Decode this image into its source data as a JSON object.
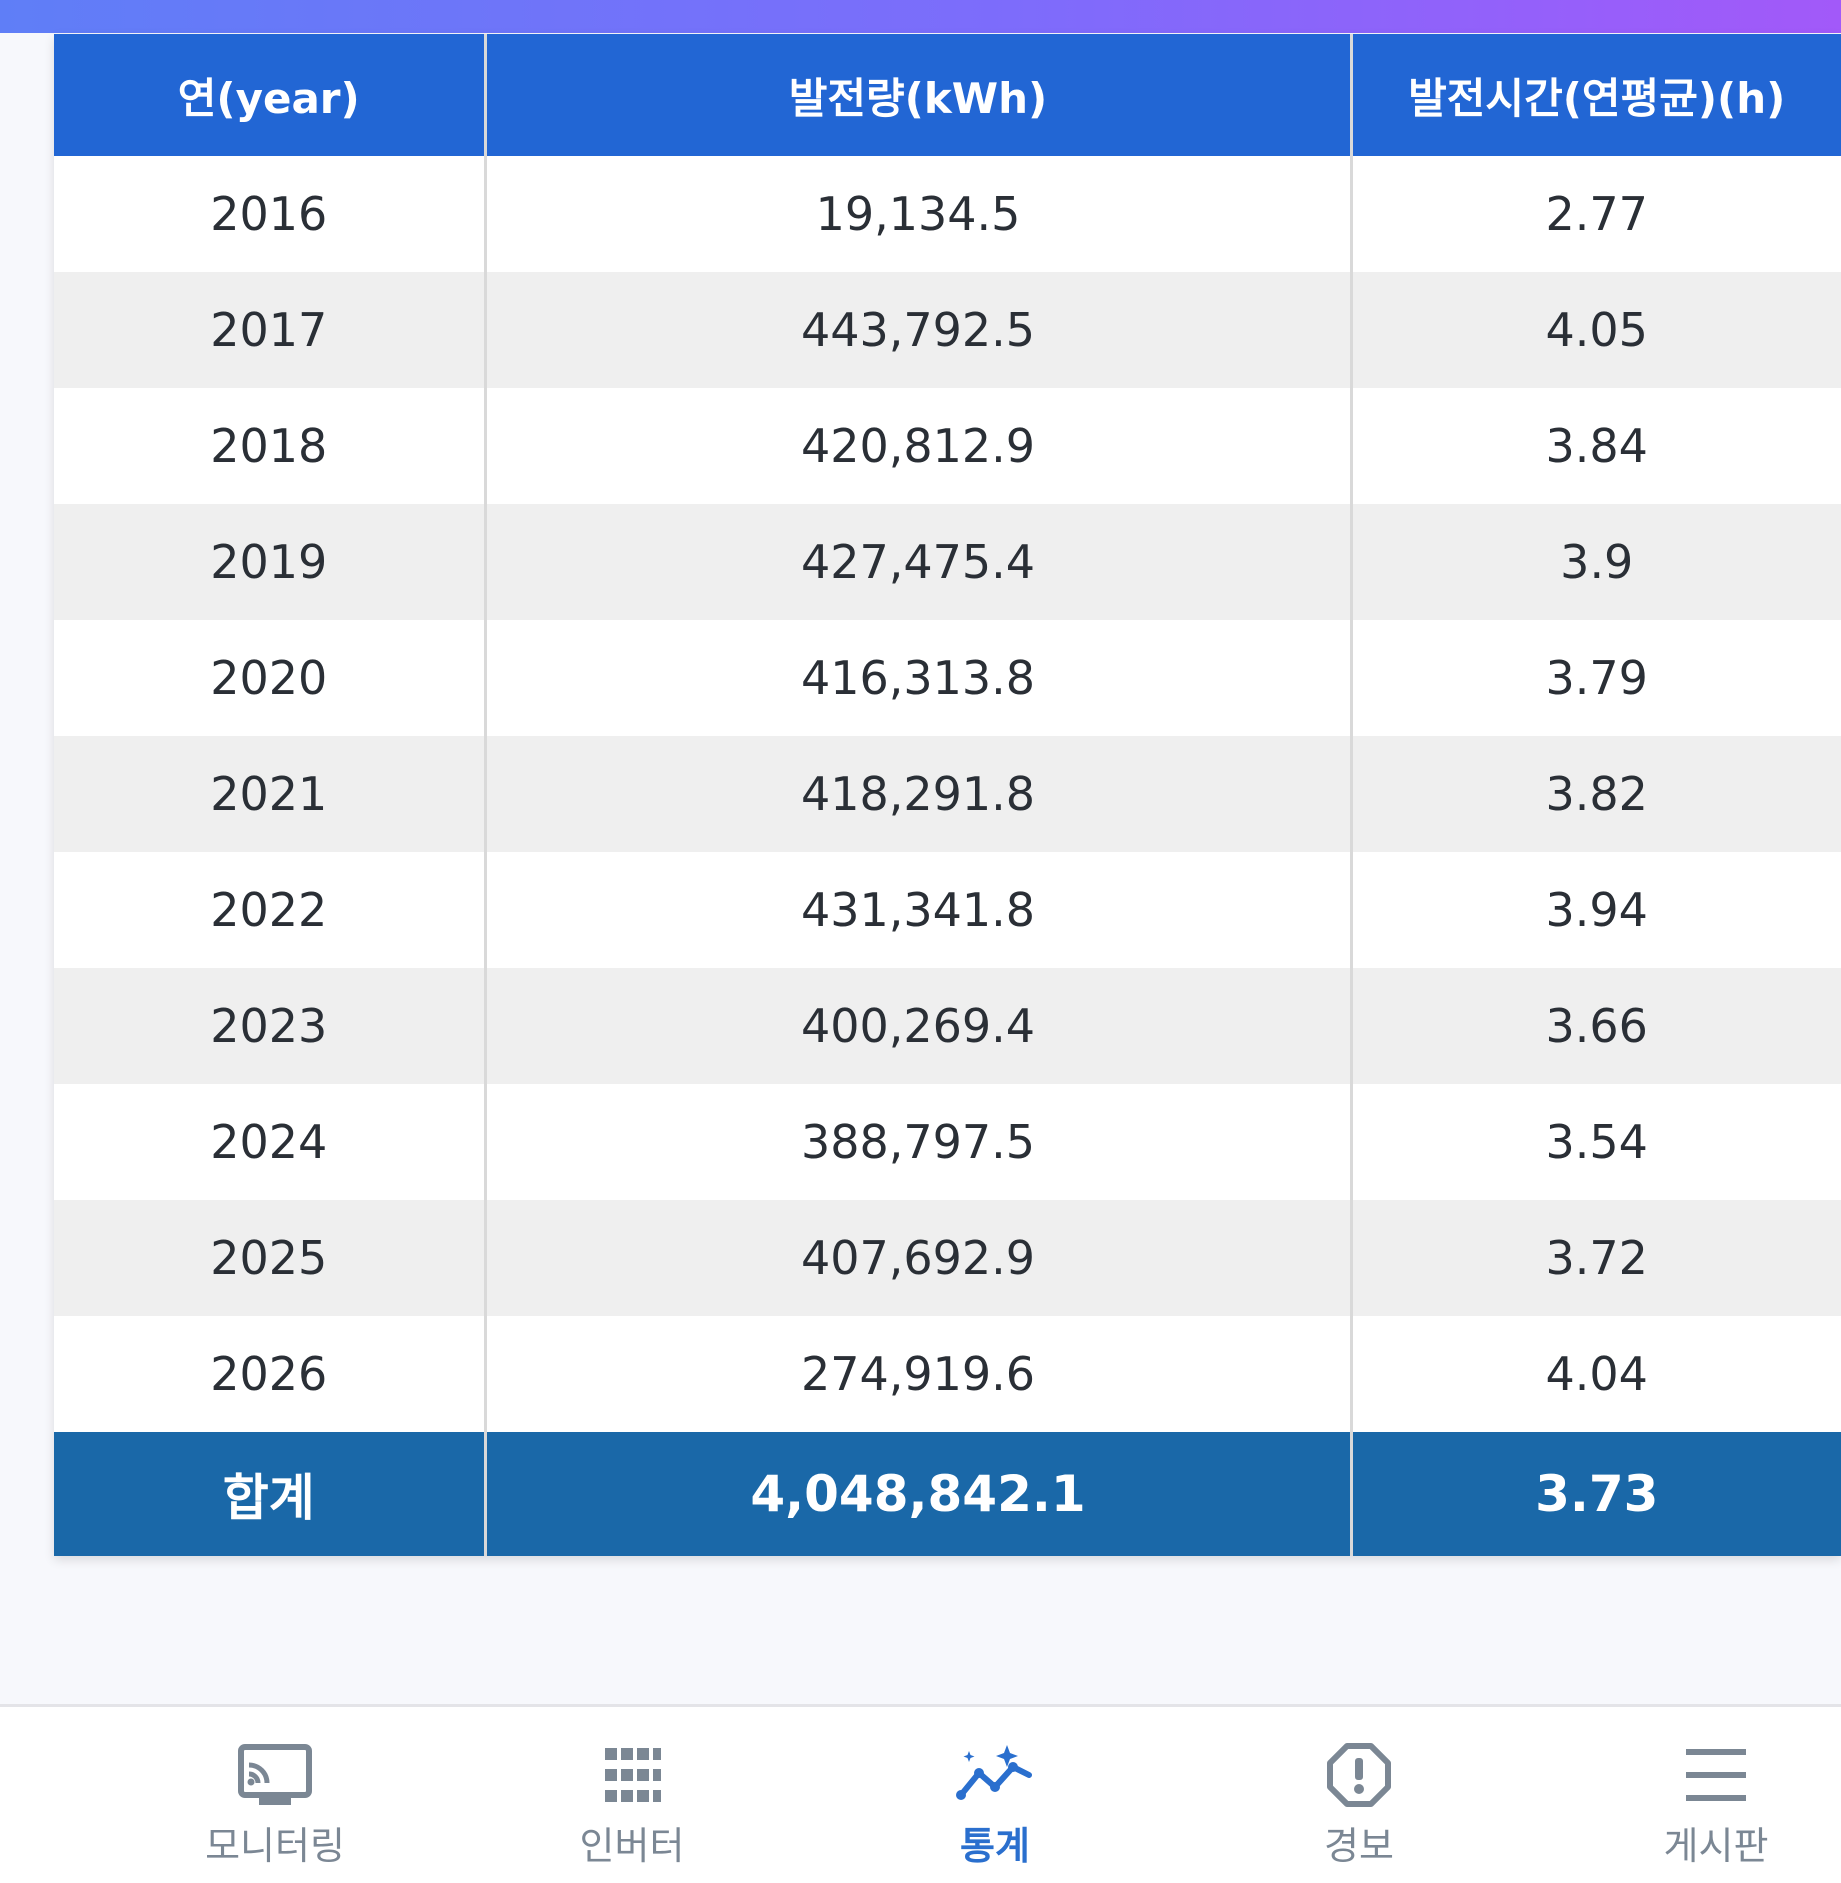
{
  "table": {
    "headers": [
      "연(year)",
      "발전량(kWh)",
      "발전시간(연평균)(h)"
    ],
    "rows": [
      {
        "year": "2016",
        "kwh": "19,134.5",
        "hours": "2.77"
      },
      {
        "year": "2017",
        "kwh": "443,792.5",
        "hours": "4.05"
      },
      {
        "year": "2018",
        "kwh": "420,812.9",
        "hours": "3.84"
      },
      {
        "year": "2019",
        "kwh": "427,475.4",
        "hours": "3.9"
      },
      {
        "year": "2020",
        "kwh": "416,313.8",
        "hours": "3.79"
      },
      {
        "year": "2021",
        "kwh": "418,291.8",
        "hours": "3.82"
      },
      {
        "year": "2022",
        "kwh": "431,341.8",
        "hours": "3.94"
      },
      {
        "year": "2023",
        "kwh": "400,269.4",
        "hours": "3.66"
      },
      {
        "year": "2024",
        "kwh": "388,797.5",
        "hours": "3.54"
      },
      {
        "year": "2025",
        "kwh": "407,692.9",
        "hours": "3.72"
      },
      {
        "year": "2026",
        "kwh": "274,919.6",
        "hours": "4.04"
      }
    ],
    "total": {
      "label": "합계",
      "kwh": "4,048,842.1",
      "hours": "3.73"
    }
  },
  "nav": {
    "items": [
      {
        "label": "모니터링",
        "icon": "cast-icon",
        "active": false
      },
      {
        "label": "인버터",
        "icon": "grid-icon",
        "active": false
      },
      {
        "label": "통계",
        "icon": "stats-sparkle-icon",
        "active": true
      },
      {
        "label": "경보",
        "icon": "alert-octagon-icon",
        "active": false
      },
      {
        "label": "게시판",
        "icon": "menu-icon",
        "active": false
      }
    ]
  },
  "colors": {
    "header_bg": "#2266d4",
    "total_bg": "#1a68a8",
    "active_nav": "#2a6fce",
    "inactive_nav": "#7b8794"
  }
}
